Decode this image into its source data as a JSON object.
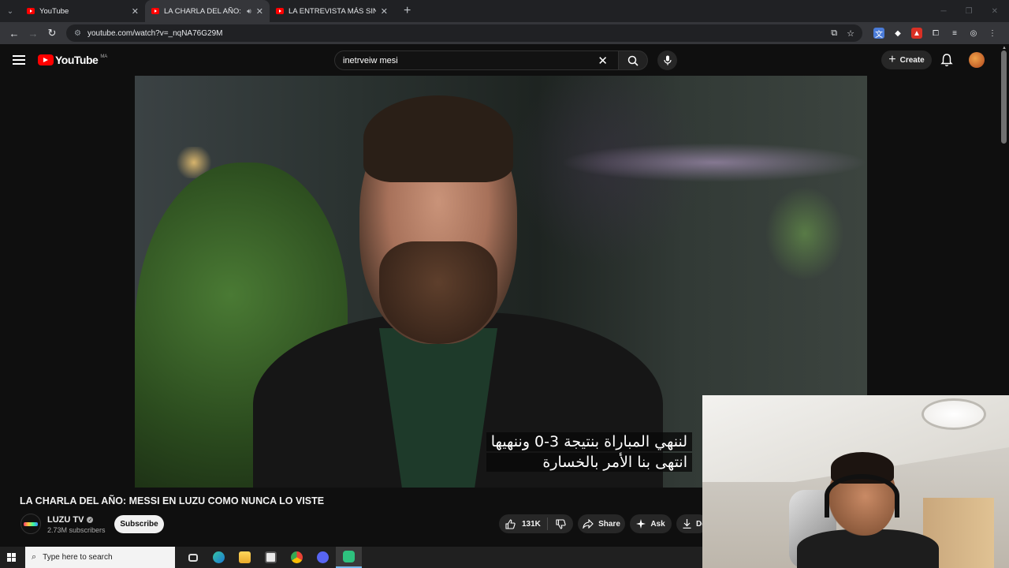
{
  "browser": {
    "tabs": [
      {
        "title": "YouTube",
        "active": false
      },
      {
        "title": "LA CHARLA DEL AÑO: MESSI",
        "active": true,
        "audio": true
      },
      {
        "title": "LA ENTREVISTA MÁS SINCERA",
        "active": false
      }
    ],
    "new_tab_label": "+",
    "url": "youtube.com/watch?v=_nqNA76G29M"
  },
  "youtube": {
    "logo_text": "YouTube",
    "country_code": "MA",
    "search_value": "inetrveiw mesi",
    "create_label": "Create"
  },
  "video": {
    "subtitle_lines": [
      "لننهي المباراة بنتيجة 3-0 وننهيها",
      "انتهى بنا الأمر بالخسارة"
    ],
    "title": "LA CHARLA DEL AÑO: MESSI EN LUZU COMO NUNCA LO VISTE",
    "channel_name": "LUZU TV",
    "channel_subscribers": "2.73M subscribers",
    "subscribe_label": "Subscribe",
    "likes": "131K",
    "share_label": "Share",
    "ask_label": "Ask",
    "download_label": "Do"
  },
  "taskbar": {
    "search_placeholder": "Type here to search",
    "apps": [
      "task-view",
      "edge",
      "file-explorer",
      "store",
      "chrome",
      "discord",
      "app"
    ]
  },
  "colors": {
    "yt_red": "#ff0000",
    "bg": "#0f0f0f",
    "chip": "#272727",
    "taskbar_accent": "#76b9ed"
  }
}
